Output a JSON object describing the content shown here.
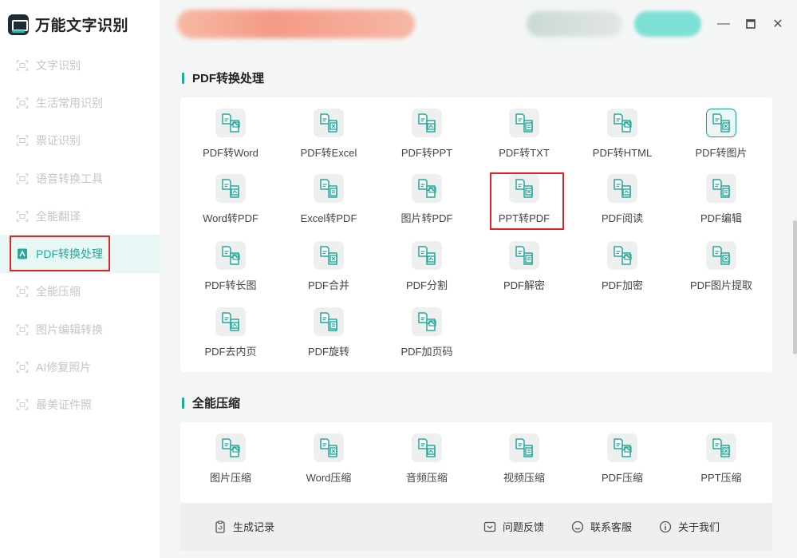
{
  "app": {
    "title": "万能文字识别"
  },
  "colors": {
    "accent": "#22a99a",
    "highlight": "#e02424",
    "nav_inactive": "#c3c6c6"
  },
  "window_controls": {
    "minimize": "—",
    "maximize": "▭",
    "close": "✕"
  },
  "sidebar": {
    "items": [
      {
        "label": "文字识别",
        "icon": "scan-text-icon",
        "active": false
      },
      {
        "label": "生活常用识别",
        "icon": "scan-text-icon",
        "active": false
      },
      {
        "label": "票证识别",
        "icon": "scan-text-icon",
        "active": false
      },
      {
        "label": "语音转换工具",
        "icon": "audio-convert-icon",
        "active": false
      },
      {
        "label": "全能翻译",
        "icon": "translate-icon",
        "active": false
      },
      {
        "label": "PDF转换处理",
        "icon": "pdf-icon",
        "active": true
      },
      {
        "label": "全能压缩",
        "icon": "compress-icon",
        "active": false
      },
      {
        "label": "图片编辑转换",
        "icon": "image-edit-icon",
        "active": false
      },
      {
        "label": "AI修复照片",
        "icon": "ai-photo-icon",
        "active": false
      },
      {
        "label": "最美证件照",
        "icon": "id-photo-icon",
        "active": false
      }
    ]
  },
  "pdf_section": {
    "title": "PDF转换处理",
    "tools": [
      {
        "label": "PDF转Word",
        "icon": "pdf-to-word-icon"
      },
      {
        "label": "PDF转Excel",
        "icon": "pdf-to-excel-icon"
      },
      {
        "label": "PDF转PPT",
        "icon": "pdf-to-ppt-icon"
      },
      {
        "label": "PDF转TXT",
        "icon": "pdf-to-txt-icon"
      },
      {
        "label": "PDF转HTML",
        "icon": "pdf-to-html-icon"
      },
      {
        "label": "PDF转图片",
        "icon": "pdf-to-image-icon"
      },
      {
        "label": "Word转PDF",
        "icon": "word-to-pdf-icon"
      },
      {
        "label": "Excel转PDF",
        "icon": "excel-to-pdf-icon"
      },
      {
        "label": "图片转PDF",
        "icon": "image-to-pdf-icon"
      },
      {
        "label": "PPT转PDF",
        "icon": "ppt-to-pdf-icon"
      },
      {
        "label": "PDF阅读",
        "icon": "pdf-read-icon"
      },
      {
        "label": "PDF编辑",
        "icon": "pdf-edit-icon"
      },
      {
        "label": "PDF转长图",
        "icon": "pdf-to-long-image-icon"
      },
      {
        "label": "PDF合并",
        "icon": "pdf-merge-icon"
      },
      {
        "label": "PDF分割",
        "icon": "pdf-split-icon"
      },
      {
        "label": "PDF解密",
        "icon": "pdf-decrypt-icon"
      },
      {
        "label": "PDF加密",
        "icon": "pdf-encrypt-icon"
      },
      {
        "label": "PDF图片提取",
        "icon": "pdf-extract-image-icon"
      },
      {
        "label": "PDF去内页",
        "icon": "pdf-remove-page-icon"
      },
      {
        "label": "PDF旋转",
        "icon": "pdf-rotate-icon"
      },
      {
        "label": "PDF加页码",
        "icon": "pdf-page-number-icon"
      }
    ]
  },
  "compress_section": {
    "title": "全能压缩",
    "tools": [
      {
        "label": "图片压缩",
        "icon": "image-compress-icon"
      },
      {
        "label": "Word压缩",
        "icon": "word-compress-icon"
      },
      {
        "label": "音频压缩",
        "icon": "audio-compress-icon"
      },
      {
        "label": "视频压缩",
        "icon": "video-compress-icon"
      },
      {
        "label": "PDF压缩",
        "icon": "pdf-compress-icon"
      },
      {
        "label": "PPT压缩",
        "icon": "ppt-compress-icon"
      }
    ]
  },
  "footer": {
    "history": "生成记录",
    "feedback": "问题反馈",
    "support": "联系客服",
    "about": "关于我们"
  }
}
